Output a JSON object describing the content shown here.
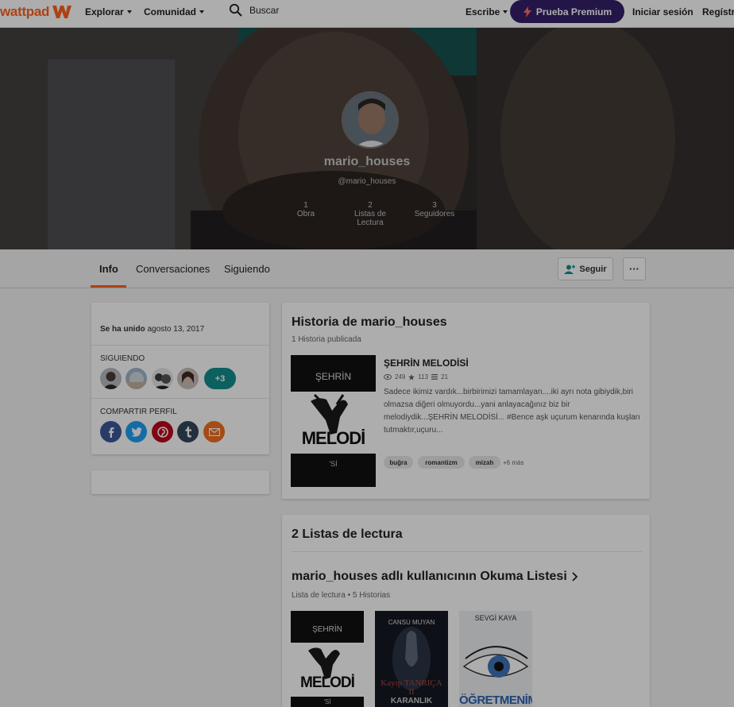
{
  "nav": {
    "logo_text": "wattpad",
    "explore": "Explorar",
    "community": "Comunidad",
    "search_label": "Buscar",
    "write": "Escribe",
    "premium": "Prueba Premium",
    "login": "Iniciar sesión",
    "register": "Regístra"
  },
  "profile": {
    "username": "mario_houses",
    "handle": "@mario_houses",
    "stats": [
      {
        "value": "1",
        "label": "Obra"
      },
      {
        "value": "2",
        "label": "Listas de Lectura"
      },
      {
        "value": "3",
        "label": "Seguidores"
      }
    ]
  },
  "tabs": {
    "info": "Info",
    "conversations": "Conversaciones",
    "following": "Siguiendo",
    "follow_button": "Seguir",
    "more_button": "···"
  },
  "sidebar": {
    "joined_label": "Se ha unido",
    "joined_date": "agosto 13, 2017",
    "following_heading": "SIGUIENDO",
    "following_more": "+3",
    "share_heading": "COMPARTIR PERFIL"
  },
  "stories": {
    "title": "Historia de mario_houses",
    "subtitle": "1 Historia publicada",
    "story": {
      "title": "ŞEHRİN MELODİSİ",
      "reads": "249",
      "votes": "113",
      "parts": "21",
      "description": "Sadece ikimiz vardık...birbirimizi tamamlayan....iki ayrı nota gibiydik,biri olmazsa diğeri olmuyordu...yani anlayacağınız biz bir melodiydik...ŞEHRİN MELODİSİ... #Bence aşk uçurum kenarında kuşları tutmaktır,uçuru...",
      "tags": [
        "buğra",
        "romantizm",
        "mizah"
      ],
      "more_tags": "+6 más",
      "cover_top": "ŞEHRİN",
      "cover_main": "MELODİ",
      "cover_bottom": "'Sİ"
    }
  },
  "reading_lists": {
    "title": "2 Listas de lectura",
    "list_title": "mario_houses adlı kullanıcının Okuma Listesi",
    "list_meta": "Lista de lectura • 5 Historias",
    "covers": [
      {
        "top": "ŞEHRİN",
        "main": "MELODİ",
        "bottom": "'Sİ"
      },
      {
        "top": "CANSU MUYAN",
        "main": "Kayıp TANRIÇA II",
        "bottom": "KARANLIK"
      },
      {
        "top": "SEVGİ KAYA",
        "main": "ÖĞRETMENİM",
        "bottom": ""
      }
    ]
  },
  "colors": {
    "brand": "#ff6122",
    "premium": "#36206b",
    "teal": "#138e8d",
    "facebook": "#3b5998",
    "twitter": "#1da1f2",
    "pinterest": "#bd081c",
    "tumblr": "#35465c",
    "email": "#f26f21"
  }
}
